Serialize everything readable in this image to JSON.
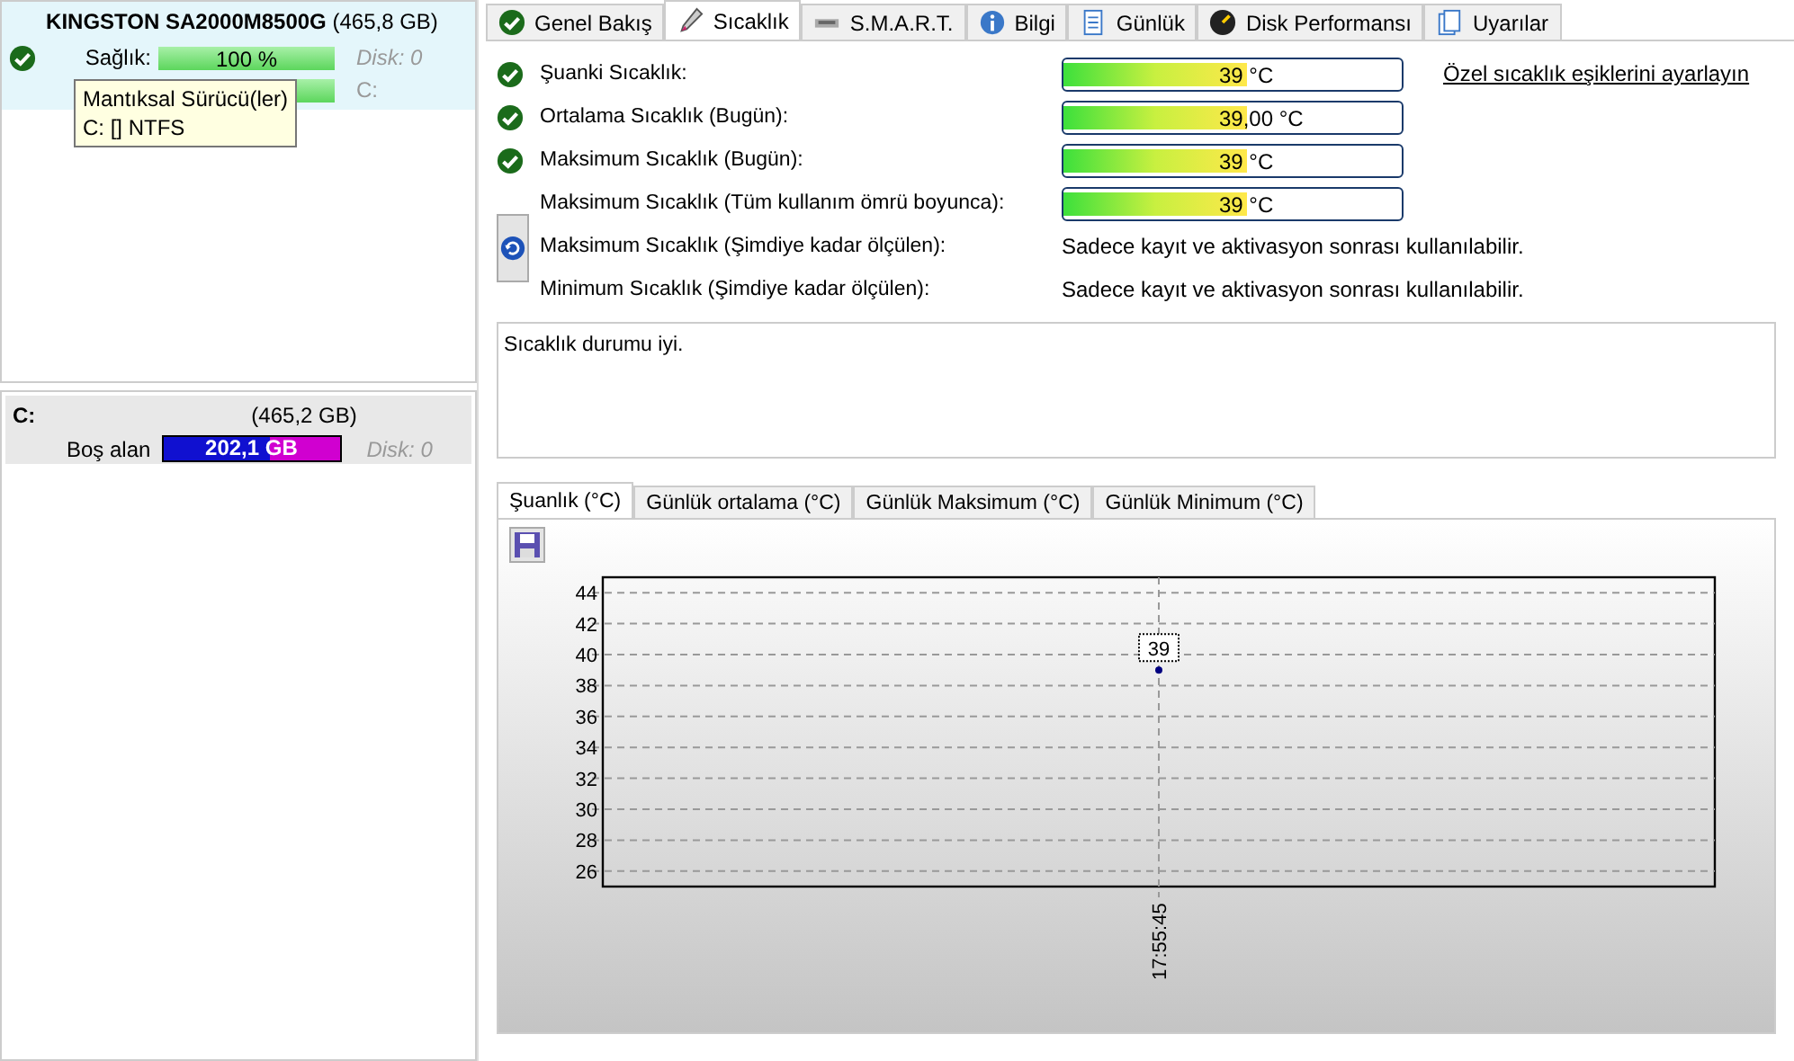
{
  "disk": {
    "title": "KINGSTON SA2000M8500G",
    "size": "(465,8 GB)",
    "health_label": "Sağlık:",
    "health": {
      "value": "100 %",
      "level": 1
    },
    "health_disk": "Disk: 0",
    "second_drive": "C:",
    "tooltip": [
      "Mantıksal Sürücü(ler)",
      "C: [] NTFS"
    ]
  },
  "volume": {
    "letter": "C:",
    "size": "(465,2 GB)",
    "free_label": "Boş alan",
    "free_value": "202,1 GB",
    "level": 0.6,
    "disk": "Disk: 0"
  },
  "tabs": [
    {
      "label": "Genel Bakış",
      "selected": false
    },
    {
      "label": "Sıcaklık",
      "selected": true
    },
    {
      "label": "S.M.A.R.T.",
      "selected": false
    },
    {
      "label": "Bilgi",
      "selected": false
    },
    {
      "label": "Günlük",
      "selected": false
    },
    {
      "label": "Disk Performansı",
      "selected": false
    },
    {
      "label": "Uyarılar",
      "selected": false
    }
  ],
  "rows": [
    {
      "kind": "bar",
      "ok": true,
      "label": "Şuanki Sıcaklık:",
      "value": "39 °C",
      "level": 0.54
    },
    {
      "kind": "bar",
      "ok": true,
      "label": "Ortalama Sıcaklık (Bugün):",
      "value": "39,00 °C",
      "level": 0.54
    },
    {
      "kind": "bar",
      "ok": true,
      "label": "Maksimum Sıcaklık (Bugün):",
      "value": "39 °C",
      "level": 0.54
    },
    {
      "kind": "bar",
      "ok": false,
      "label": "Maksimum Sıcaklık (Tüm kullanım ömrü boyunca):",
      "value": "39 °C",
      "level": 0.54
    },
    {
      "kind": "text",
      "ok": false,
      "label": "Maksimum Sıcaklık (Şimdiye kadar ölçülen):",
      "value": "Sadece kayıt ve aktivasyon sonrası kullanılabilir."
    },
    {
      "kind": "text",
      "ok": false,
      "label": "Minimum Sıcaklık (Şimdiye kadar ölçülen):",
      "value": "Sadece kayıt ve aktivasyon sonrası kullanılabilir."
    }
  ],
  "threshold_link": "Özel sıcaklık eşiklerini ayarlayın",
  "status_text": "Sıcaklık durumu iyi.",
  "chart_tabs": [
    {
      "label": "Şuanlık (°C)",
      "selected": true
    },
    {
      "label": "Günlük ortalama (°C)",
      "selected": false
    },
    {
      "label": "Günlük Maksimum (°C)",
      "selected": false
    },
    {
      "label": "Günlük Minimum (°C)",
      "selected": false
    }
  ],
  "chart_data": {
    "type": "line",
    "categories": [
      "17:55:45"
    ],
    "series": [
      {
        "color": "#000080",
        "values": [
          39
        ],
        "marker": true
      }
    ],
    "ylim": [
      25,
      45
    ],
    "yticks": [
      26,
      28,
      30,
      32,
      34,
      36,
      38,
      40,
      42,
      44
    ],
    "grid": true,
    "data_labels": true
  }
}
